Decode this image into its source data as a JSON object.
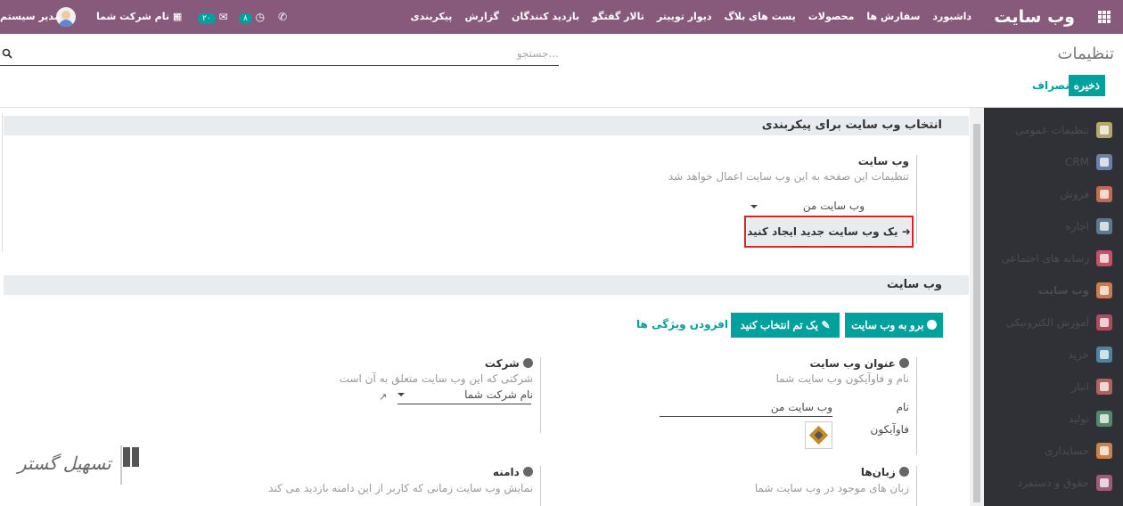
{
  "topbar": {
    "brand": "وب سایت",
    "menu": [
      "داشبورد",
      "سفارش ها",
      "محصولات",
      "پست های بلاگ",
      "دیوار توییتر",
      "تالار گفتگو",
      "بازدید کنندگان",
      "گزارش",
      "پیکربندی"
    ],
    "user": "مدیر سیستم",
    "company": "نام شرکت شما",
    "messages_count": "۲۰",
    "activities_count": "۸"
  },
  "control_panel": {
    "title": "تنظیمات",
    "search_placeholder": "جستجو...",
    "save": "ذخیره",
    "discard": "انصراف"
  },
  "sidebar": {
    "items": [
      {
        "label": "تنظیمات عمومی",
        "icon": "gear-icon",
        "color": "#b5a76a"
      },
      {
        "label": "CRM",
        "icon": "handshake-icon",
        "color": "#6b7fa8"
      },
      {
        "label": "فروش",
        "icon": "chart-icon",
        "color": "#c26b4f"
      },
      {
        "label": "اجاره",
        "icon": "car-icon",
        "color": "#5c7a8f"
      },
      {
        "label": "رسانه های اجتماعی",
        "icon": "thumbs-up-icon",
        "color": "#c84f65"
      },
      {
        "label": "وب سایت",
        "icon": "globe-icon",
        "color": "#d07a4a"
      },
      {
        "label": "آموزش الکترونیکی",
        "icon": "elearning-icon",
        "color": "#b04a5c"
      },
      {
        "label": "خرید",
        "icon": "card-icon",
        "color": "#4a86a0"
      },
      {
        "label": "انبار",
        "icon": "box-icon",
        "color": "#b0625e"
      },
      {
        "label": "تولید",
        "icon": "wrench-icon",
        "color": "#4f8a6a"
      },
      {
        "label": "حسابداری",
        "icon": "invoice-icon",
        "color": "#c9824a"
      },
      {
        "label": "حقوق و دستمزد",
        "icon": "payroll-icon",
        "color": "#a05a7a"
      }
    ],
    "active_index": 5
  },
  "section_select": {
    "header": "انتخاب وب سایت برای پیکربندی",
    "field_title": "وب سایت",
    "field_help": "تنظیمات این صفحه به این وب سایت اعمال خواهد شد",
    "selected_website": "وب سایت من",
    "create_button": "یک وب سایت جدید ایجاد کنید"
  },
  "section_website": {
    "header": "وب سایت",
    "go_to_website": "برو به وب سایت",
    "pick_theme": "یک تم انتخاب کنید",
    "add_feature": "افزودن ویژگی ها",
    "title_setting": {
      "title": "عنوان وب سایت",
      "help": "نام و فاوآیکون وب سایت شما",
      "name_label": "نام",
      "name_value": "وب سایت من",
      "favicon_label": "فاوآیکون"
    },
    "company_setting": {
      "title": "شرکت",
      "help": "شرکتی که این وب سایت متعلق به آن است",
      "value": "نام شرکت شما"
    },
    "languages_setting": {
      "title": "زبان‌ها",
      "help": "زبان های موجود در وب سایت شما"
    },
    "domain_setting": {
      "title": "دامنه",
      "help": "نمایش وب سایت زمانی که کاربر از این دامنه بازدید می کند"
    }
  },
  "watermark": "تسهیل گستر"
}
